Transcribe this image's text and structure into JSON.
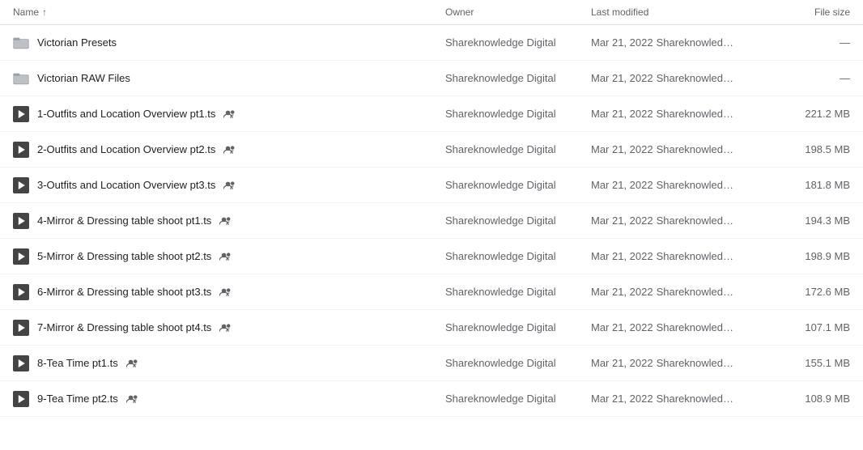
{
  "header": {
    "col_name": "Name",
    "col_owner": "Owner",
    "col_modified": "Last modified",
    "col_size": "File size"
  },
  "rows": [
    {
      "type": "folder",
      "name": "Victorian Presets",
      "shared": false,
      "owner": "Shareknowledge Digital",
      "modified_date": "Mar 21, 2022",
      "modified_user": "Shareknowledge...",
      "size": "—"
    },
    {
      "type": "folder",
      "name": "Victorian RAW Files",
      "shared": false,
      "owner": "Shareknowledge Digital",
      "modified_date": "Mar 21, 2022",
      "modified_user": "Shareknowledge...",
      "size": "—"
    },
    {
      "type": "video",
      "name": "1-Outfits and Location Overview pt1.ts",
      "shared": true,
      "owner": "Shareknowledge Digital",
      "modified_date": "Mar 21, 2022",
      "modified_user": "Shareknowledge...",
      "size": "221.2 MB"
    },
    {
      "type": "video",
      "name": "2-Outfits and Location Overview pt2.ts",
      "shared": true,
      "owner": "Shareknowledge Digital",
      "modified_date": "Mar 21, 2022",
      "modified_user": "Shareknowledge...",
      "size": "198.5 MB"
    },
    {
      "type": "video",
      "name": "3-Outfits and Location Overview pt3.ts",
      "shared": true,
      "owner": "Shareknowledge Digital",
      "modified_date": "Mar 21, 2022",
      "modified_user": "Shareknowledge...",
      "size": "181.8 MB"
    },
    {
      "type": "video",
      "name": "4-Mirror & Dressing table shoot pt1.ts",
      "shared": true,
      "owner": "Shareknowledge Digital",
      "modified_date": "Mar 21, 2022",
      "modified_user": "Shareknowledge...",
      "size": "194.3 MB"
    },
    {
      "type": "video",
      "name": "5-Mirror & Dressing table shoot pt2.ts",
      "shared": true,
      "owner": "Shareknowledge Digital",
      "modified_date": "Mar 21, 2022",
      "modified_user": "Shareknowledge...",
      "size": "198.9 MB"
    },
    {
      "type": "video",
      "name": "6-Mirror & Dressing table shoot pt3.ts",
      "shared": true,
      "owner": "Shareknowledge Digital",
      "modified_date": "Mar 21, 2022",
      "modified_user": "Shareknowledge...",
      "size": "172.6 MB"
    },
    {
      "type": "video",
      "name": "7-Mirror & Dressing table shoot pt4.ts",
      "shared": true,
      "owner": "Shareknowledge Digital",
      "modified_date": "Mar 21, 2022",
      "modified_user": "Shareknowledge...",
      "size": "107.1 MB"
    },
    {
      "type": "video",
      "name": "8-Tea Time pt1.ts",
      "shared": true,
      "owner": "Shareknowledge Digital",
      "modified_date": "Mar 21, 2022",
      "modified_user": "Shareknowledge...",
      "size": "155.1 MB"
    },
    {
      "type": "video",
      "name": "9-Tea Time pt2.ts",
      "shared": true,
      "owner": "Shareknowledge Digital",
      "modified_date": "Mar 21, 2022",
      "modified_user": "Shareknowledge...",
      "size": "108.9 MB"
    }
  ]
}
